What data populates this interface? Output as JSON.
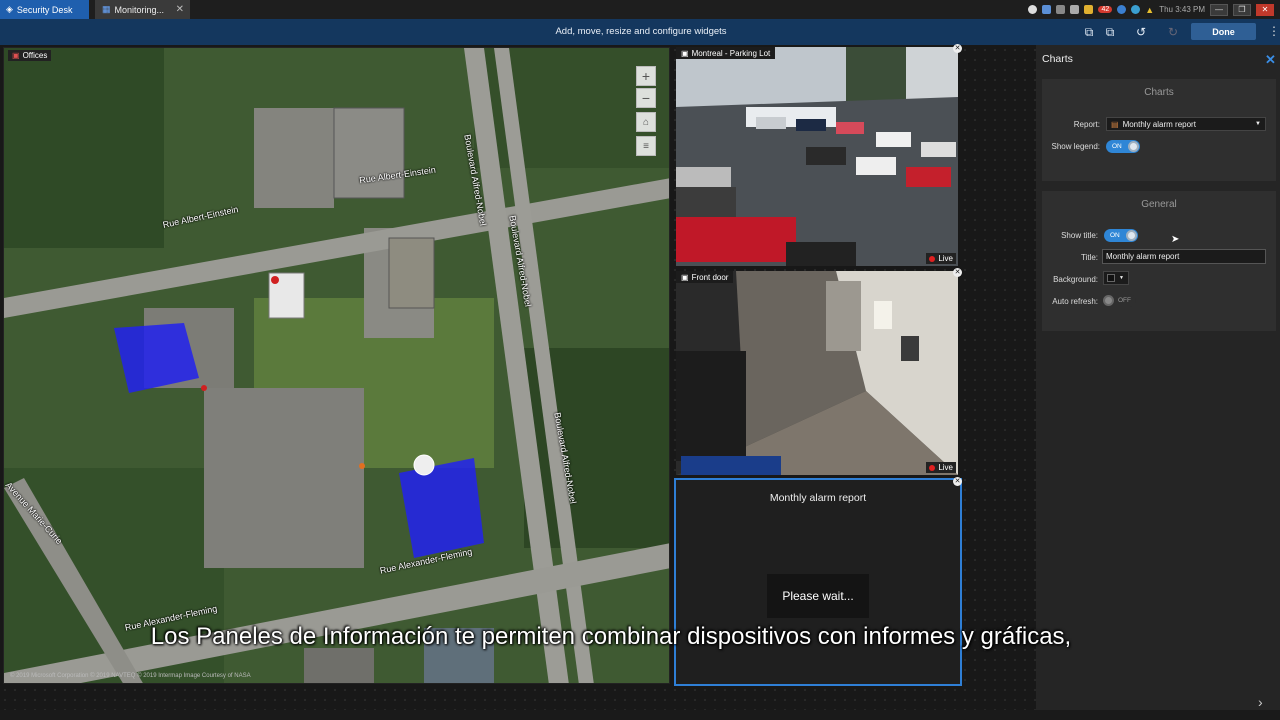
{
  "tabs": {
    "security_desk": "Security Desk",
    "monitoring": "Monitoring..."
  },
  "tray": {
    "alarm_count": "42",
    "clock": "Thu 3:43 PM"
  },
  "toolbar": {
    "message": "Add, move, resize and configure widgets",
    "done_label": "Done"
  },
  "map": {
    "title": "Offices",
    "streets": [
      "Rue Albert-Einstein",
      "Rue Albert-Einstein",
      "Boulevard Alfred-Nobel",
      "Boulevard Alfred-Nobel",
      "Boulevard Alfred-Nobel",
      "Rue Alexander-Fleming",
      "Rue Alexander-Fleming",
      "Avenue Marie-Curie"
    ],
    "copyright": "© 2019 Microsoft Corporation © 2019 NAVTEQ © 2019 Intermap Image Courtesy of NASA"
  },
  "cameras": [
    {
      "title": "Montreal - Parking Lot",
      "status": "Live"
    },
    {
      "title": "Front door",
      "status": "Live"
    }
  ],
  "chart_widget": {
    "title": "Monthly alarm report",
    "loading": "Please wait..."
  },
  "panel": {
    "header": "Charts",
    "charts_group": {
      "title": "Charts",
      "report_label": "Report:",
      "report_value": "Monthly alarm report",
      "show_legend_label": "Show legend:",
      "show_legend_state": "ON"
    },
    "general_group": {
      "title": "General",
      "show_title_label": "Show title:",
      "show_title_state": "ON",
      "title_label": "Title:",
      "title_value": "Monthly alarm report",
      "background_label": "Background:",
      "auto_refresh_label": "Auto refresh:",
      "auto_refresh_state": "OFF"
    }
  },
  "subtitle": "Los Paneles de Información te permiten combinar dispositivos con informes y gráficas,"
}
